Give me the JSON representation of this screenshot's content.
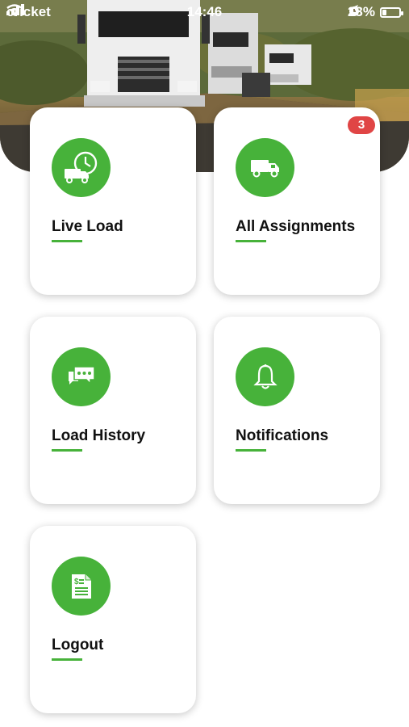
{
  "status_bar": {
    "carrier": "cricket",
    "time": "14:46",
    "battery_percent": "23%",
    "battery_level": 0.23
  },
  "colors": {
    "accent": "#47b23a",
    "badge": "#e04545"
  },
  "menu": [
    {
      "label": "Live Load",
      "icon": "truck-clock-icon"
    },
    {
      "label": "All Assignments",
      "icon": "truck-icon",
      "badge": "3"
    },
    {
      "label": "Load History",
      "icon": "chat-bubbles-icon"
    },
    {
      "label": "Notifications",
      "icon": "bell-icon"
    },
    {
      "label": "Logout",
      "icon": "invoice-document-icon"
    }
  ]
}
